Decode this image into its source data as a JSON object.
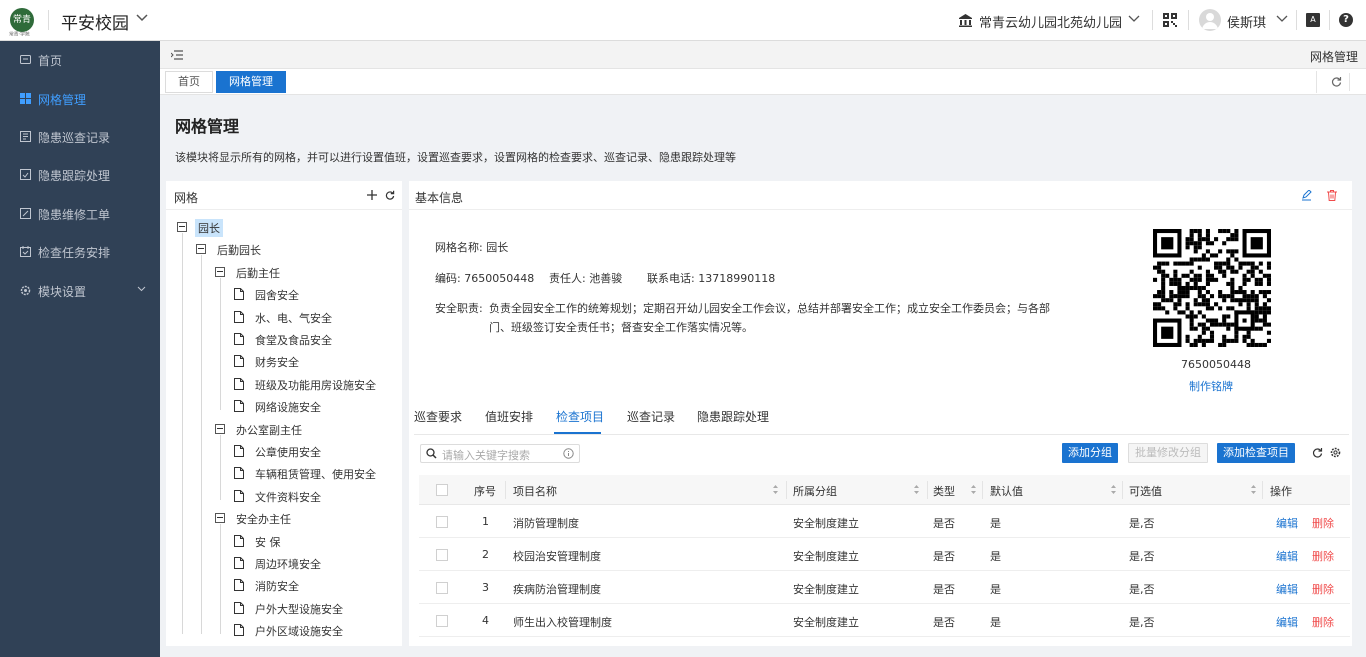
{
  "topbar": {
    "logo_text": "常青",
    "logo_sub": "常青·学苑",
    "app_title": "平安校园",
    "school": "常青云幼儿园北苑幼儿园",
    "user": "侯斯琪",
    "translate_label": "A"
  },
  "sidebar": {
    "items": [
      {
        "label": "首页",
        "icon": "home-icon"
      },
      {
        "label": "网格管理",
        "icon": "grid-icon",
        "active": true
      },
      {
        "label": "隐患巡查记录",
        "icon": "record-icon"
      },
      {
        "label": "隐患跟踪处理",
        "icon": "track-icon"
      },
      {
        "label": "隐患维修工单",
        "icon": "repair-icon"
      },
      {
        "label": "检查任务安排",
        "icon": "task-icon"
      },
      {
        "label": "模块设置",
        "icon": "settings-icon"
      }
    ]
  },
  "header": {
    "title": "网格管理"
  },
  "page_tabs": [
    "首页",
    "网格管理"
  ],
  "page": {
    "title": "网格管理",
    "desc": "该模块将显示所有的网格，并可以进行设置值班，设置巡查要求，设置网格的检查要求、巡查记录、隐患跟踪处理等"
  },
  "tree": {
    "title": "网格",
    "nodes": [
      {
        "label": "园长",
        "level": 0,
        "type": "folder",
        "selected": true
      },
      {
        "label": "后勤园长",
        "level": 1,
        "type": "folder"
      },
      {
        "label": "后勤主任",
        "level": 2,
        "type": "folder"
      },
      {
        "label": "园舍安全",
        "level": 3,
        "type": "doc"
      },
      {
        "label": "水、电、气安全",
        "level": 3,
        "type": "doc"
      },
      {
        "label": "食堂及食品安全",
        "level": 3,
        "type": "doc"
      },
      {
        "label": "财务安全",
        "level": 3,
        "type": "doc"
      },
      {
        "label": "班级及功能用房设施安全",
        "level": 3,
        "type": "doc"
      },
      {
        "label": "网络设施安全",
        "level": 3,
        "type": "doc"
      },
      {
        "label": "办公室副主任",
        "level": 2,
        "type": "folder"
      },
      {
        "label": "公章使用安全",
        "level": 3,
        "type": "doc"
      },
      {
        "label": "车辆租赁管理、使用安全",
        "level": 3,
        "type": "doc"
      },
      {
        "label": "文件资料安全",
        "level": 3,
        "type": "doc"
      },
      {
        "label": "安全办主任",
        "level": 2,
        "type": "folder"
      },
      {
        "label": "安 保",
        "level": 3,
        "type": "doc"
      },
      {
        "label": "周边环境安全",
        "level": 3,
        "type": "doc"
      },
      {
        "label": "消防安全",
        "level": 3,
        "type": "doc"
      },
      {
        "label": "户外大型设施安全",
        "level": 3,
        "type": "doc"
      },
      {
        "label": "户外区域设施安全",
        "level": 3,
        "type": "doc"
      }
    ]
  },
  "basic": {
    "title": "基本信息",
    "name_label": "网格名称:",
    "name": "园长",
    "code_label": "编码:",
    "code": "7650050448",
    "owner_label": "责任人:",
    "owner": "池善骏",
    "phone_label": "联系电话:",
    "phone": "13718990118",
    "duty_label": "安全职责:",
    "duty_line1": "负责全园安全工作的统筹规划；定期召开幼儿园安全工作会议，总结并部署安全工作；成立安全工作委员会；与各部",
    "duty_line2": "门、班级签订安全责任书；督查安全工作落实情况等。",
    "qr_code": "7650050448",
    "qr_make": "制作铭牌"
  },
  "detail_tabs": [
    "巡查要求",
    "值班安排",
    "检查项目",
    "巡查记录",
    "隐患跟踪处理"
  ],
  "toolbar": {
    "search_placeholder": "请输入关键字搜索",
    "add_group": "添加分组",
    "batch_edit": "批量修改分组",
    "add_item": "添加检查项目"
  },
  "table": {
    "columns": [
      "序号",
      "项目名称",
      "所属分组",
      "类型",
      "默认值",
      "可选值",
      "操作"
    ],
    "rows": [
      {
        "no": "1",
        "name": "消防管理制度",
        "group": "安全制度建立",
        "type": "是否",
        "default": "是",
        "options": "是,否"
      },
      {
        "no": "2",
        "name": "校园治安管理制度",
        "group": "安全制度建立",
        "type": "是否",
        "default": "是",
        "options": "是,否"
      },
      {
        "no": "3",
        "name": "疾病防治管理制度",
        "group": "安全制度建立",
        "type": "是否",
        "default": "是",
        "options": "是,否"
      },
      {
        "no": "4",
        "name": "师生出入校管理制度",
        "group": "安全制度建立",
        "type": "是否",
        "default": "是",
        "options": "是,否"
      }
    ],
    "edit": "编辑",
    "delete": "删除"
  }
}
